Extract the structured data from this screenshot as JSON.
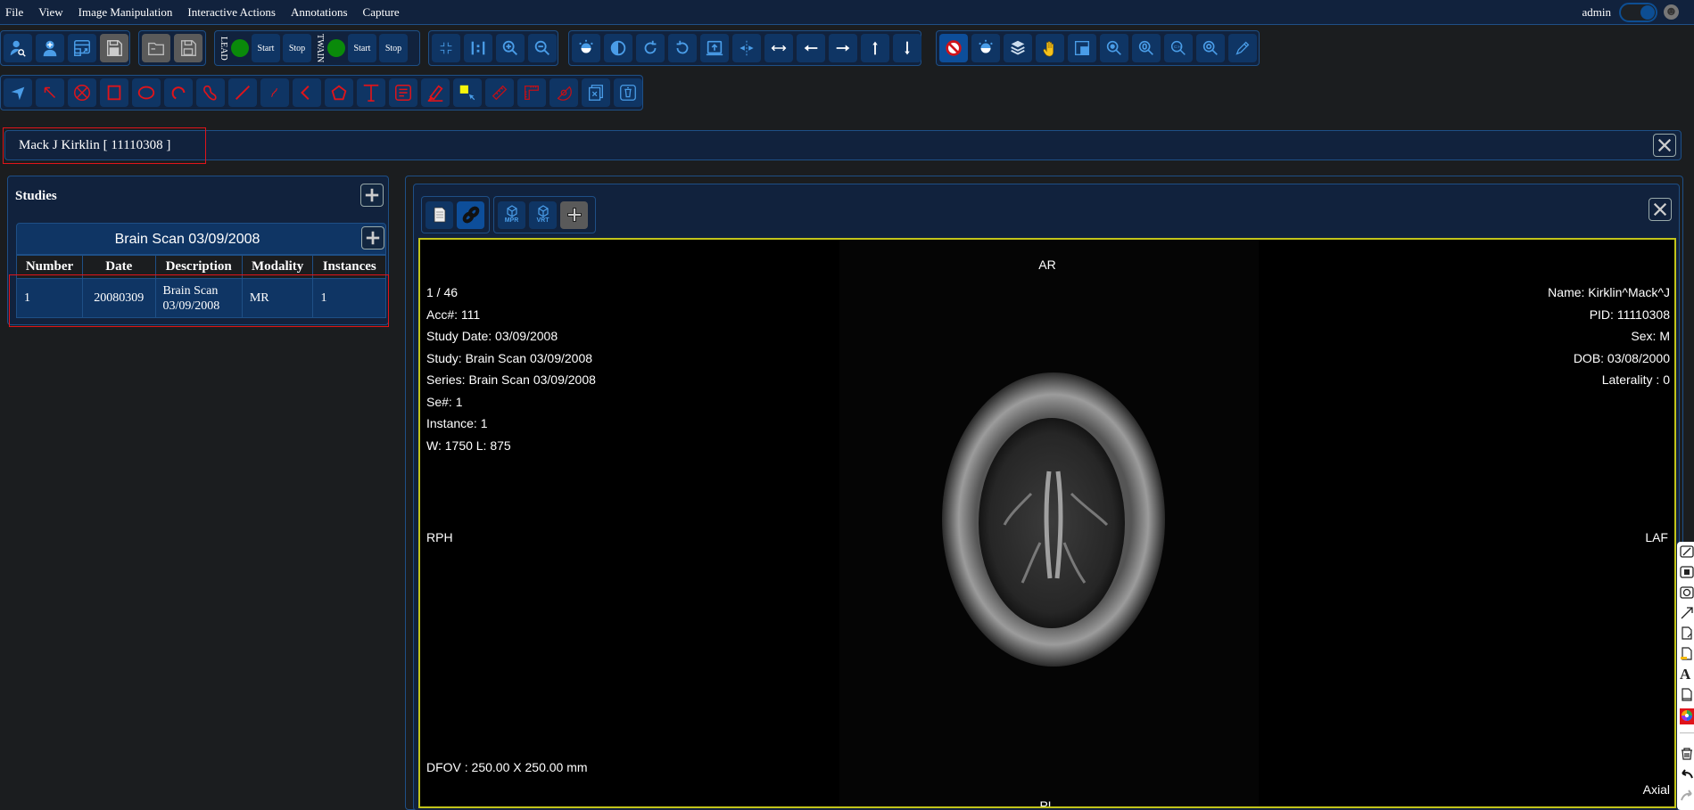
{
  "menubar": {
    "items": [
      "File",
      "View",
      "Image Manipulation",
      "Interactive Actions",
      "Annotations",
      "Capture"
    ],
    "user": "admin",
    "theme_toggle_on": true
  },
  "toolbar1": {
    "group1": [
      "search-patient",
      "add-patient",
      "window-layout",
      "save-series"
    ],
    "group2": [
      "open-folder",
      "save"
    ],
    "capture": {
      "lead_label": "LEAD",
      "twain_label": "TWAIN",
      "start_label": "Start",
      "stop_label": "Stop",
      "status_color": "#0a8a0a"
    },
    "group4": [
      "fit-to-screen",
      "actual-size",
      "zoom-in",
      "zoom-out"
    ],
    "group5": [
      "brightness",
      "contrast",
      "rotate-clockwise",
      "rotate-counterclockwise",
      "flip",
      "center",
      "fit-horizontal",
      "pan-left",
      "pan-right",
      "pan-up",
      "pan-down"
    ],
    "group6": [
      "no-action",
      "window-level",
      "stack",
      "pan-hand",
      "region",
      "magnify-glass",
      "zoom-region",
      "cine-zoom",
      "zoom-point",
      "pencil"
    ]
  },
  "toolbar2": {
    "tools": [
      "select",
      "pointer-arrow",
      "cross-out",
      "rectangle",
      "ellipse",
      "arc",
      "curve",
      "line",
      "freehand",
      "polyline",
      "polygon",
      "text",
      "note",
      "highlight",
      "hotspot",
      "ruler",
      "angle-ruler",
      "protractor",
      "delete-annotation",
      "clear-annotations"
    ]
  },
  "patient": {
    "label": "Mack J Kirklin [ 11110308 ]"
  },
  "studies": {
    "title": "Studies",
    "study_label": "Brain Scan 03/09/2008",
    "columns": [
      "Number",
      "Date",
      "Description",
      "Modality",
      "Instances"
    ],
    "rows": [
      {
        "number": "1",
        "date": "20080309",
        "description_line1": "Brain Scan",
        "description_line2": "03/09/2008",
        "modality": "MR",
        "instances": "1"
      }
    ]
  },
  "viewer": {
    "tools": [
      {
        "name": "document"
      },
      {
        "name": "link",
        "active": true
      },
      {
        "name": "mpr",
        "caption": "MPR"
      },
      {
        "name": "vrt",
        "caption": "VRT"
      },
      {
        "name": "add-viewer"
      }
    ],
    "overlay_left": [
      "1 / 46",
      "Acc#: 111",
      "Study Date: 03/09/2008",
      "Study: Brain Scan 03/09/2008",
      "Series: Brain Scan 03/09/2008",
      "Se#: 1",
      "Instance: 1",
      "W: 1750 L: 875"
    ],
    "overlay_right": [
      "Name: Kirklin^Mack^J",
      "PID: 11110308",
      "Sex: M",
      "DOB: 03/08/2000",
      "Laterality : 0"
    ],
    "orientation": {
      "top": "AR",
      "left": "RPH",
      "right": "LAF",
      "bottom": "PL"
    },
    "dfov": "DFOV : 250.00 X 250.00 mm",
    "plane": "Axial",
    "frame_border_color": "#c2c41a"
  },
  "side_toolbar": [
    "line",
    "rectangle",
    "ellipse",
    "arrow",
    "note",
    "highlight-note",
    "text",
    "stamp",
    "color-picker",
    "delete",
    "undo",
    "redo"
  ]
}
